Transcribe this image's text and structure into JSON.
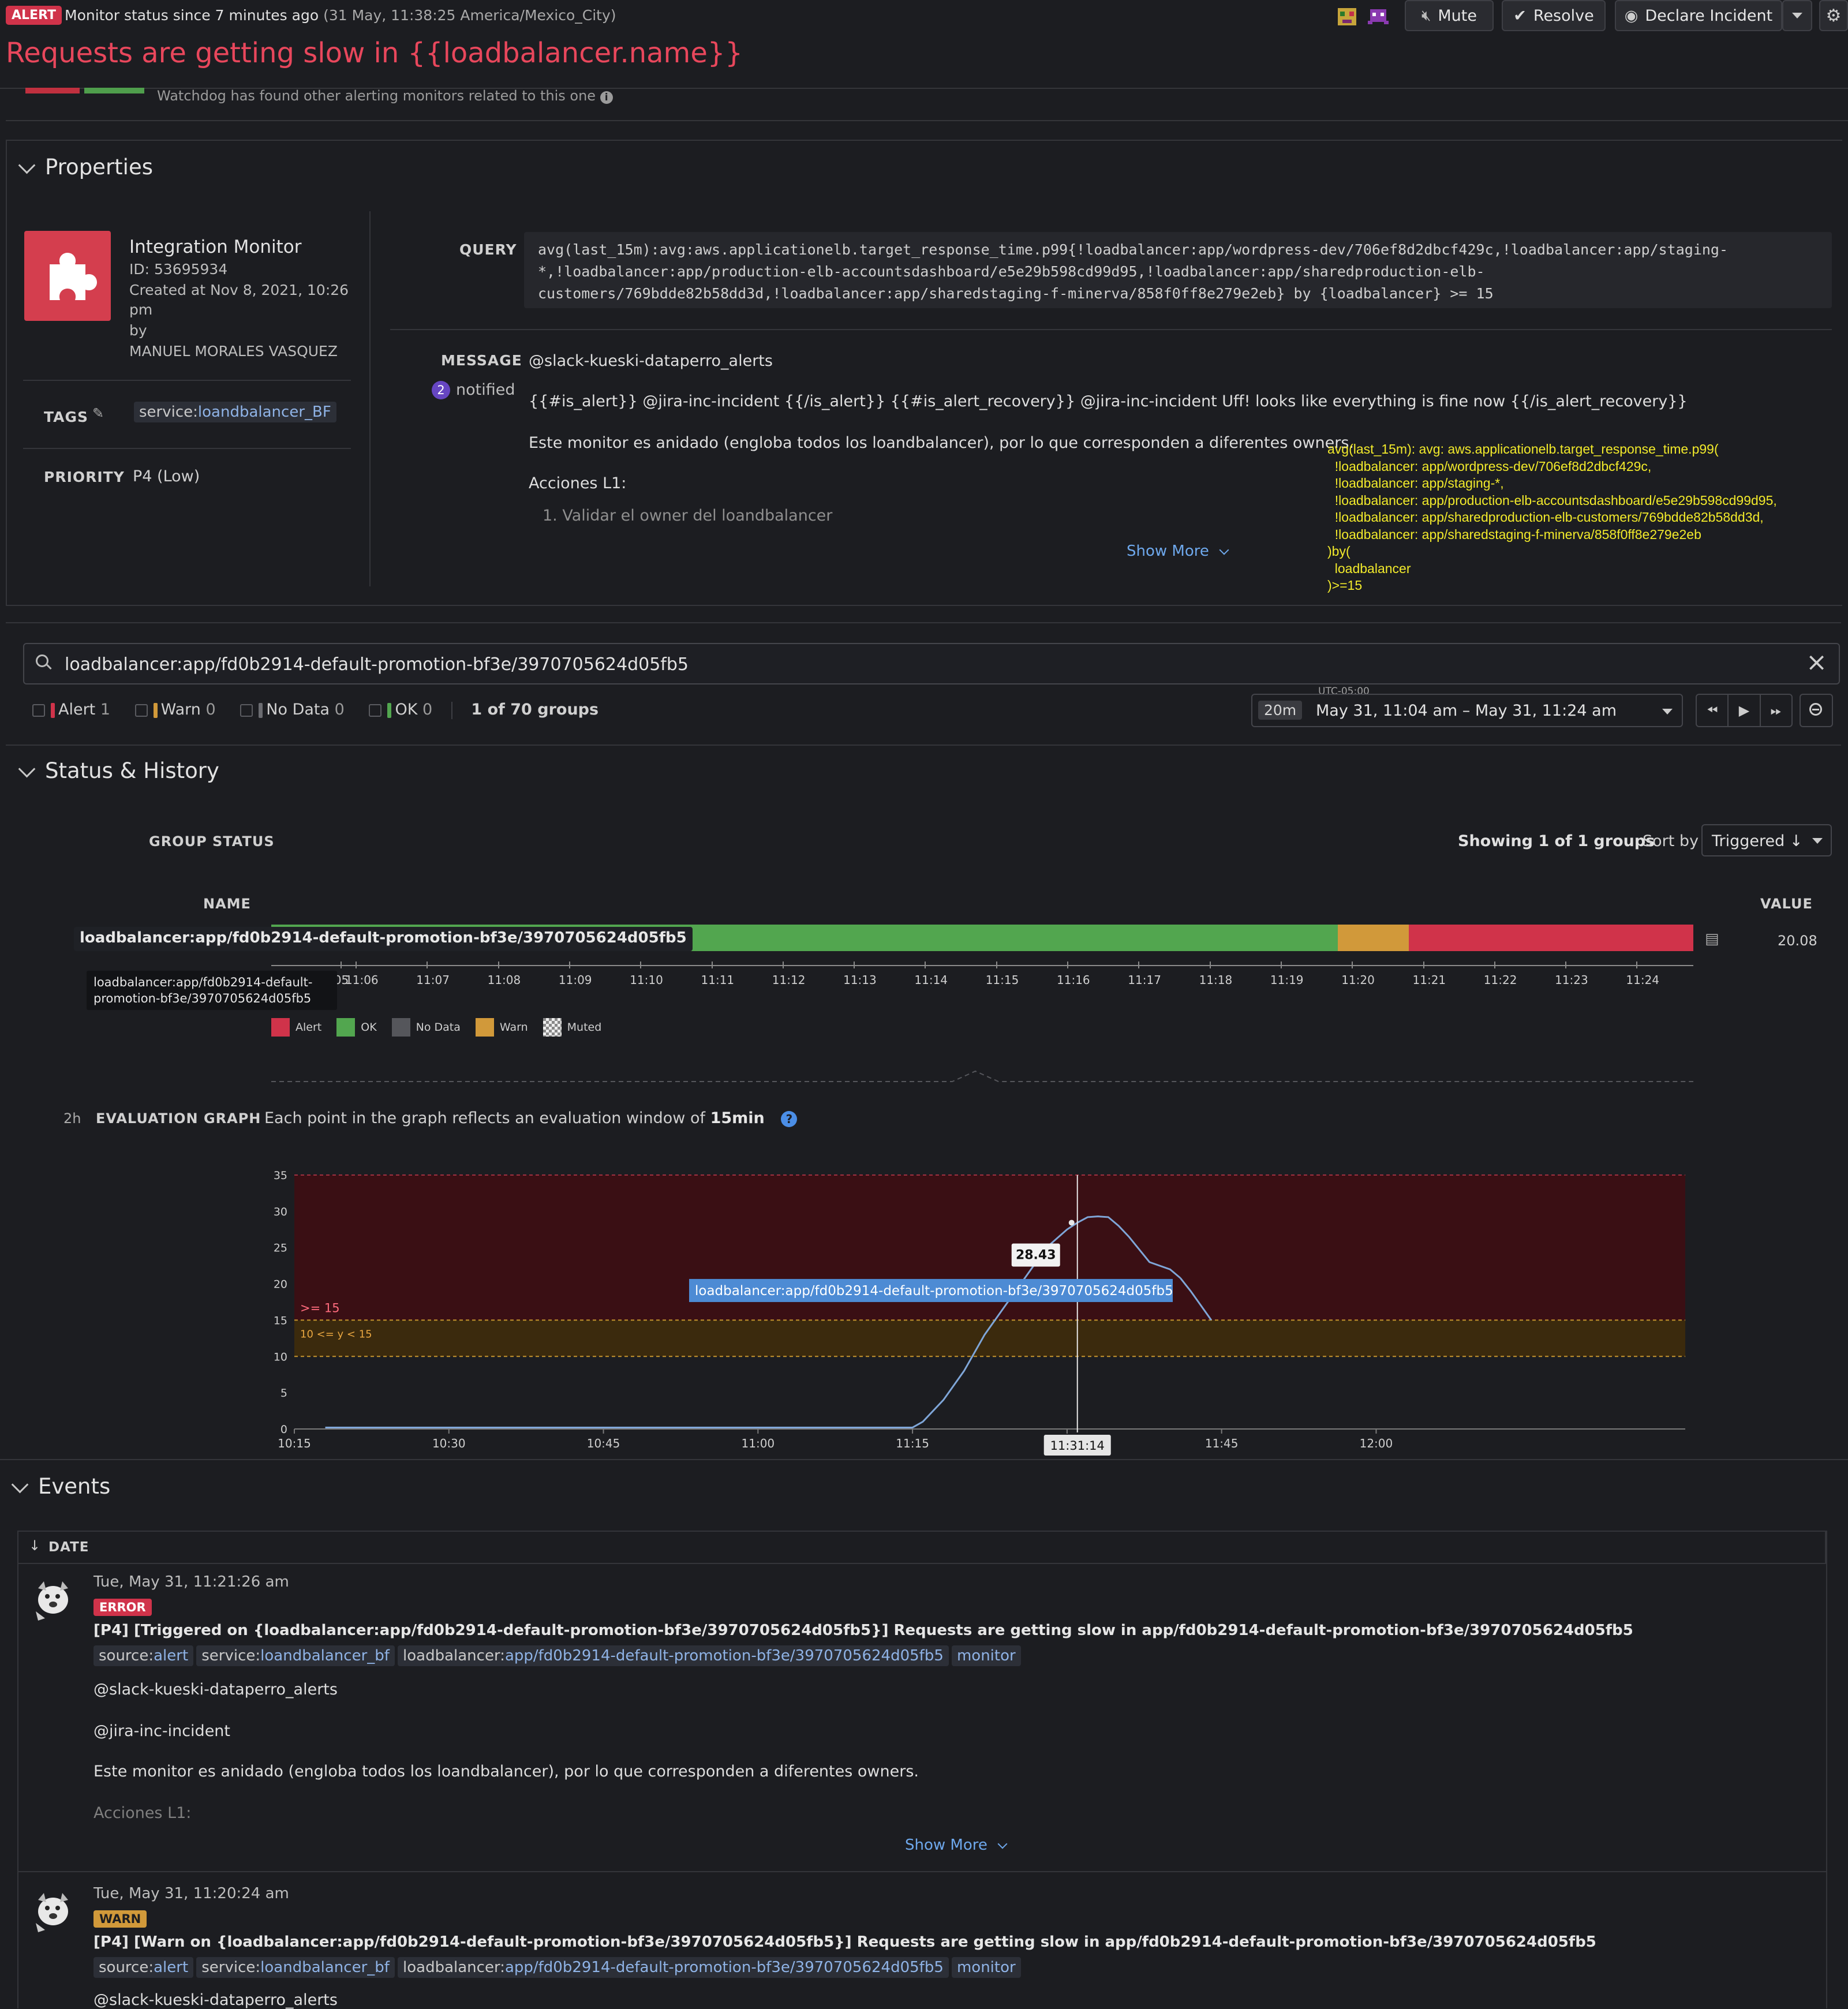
{
  "header": {
    "alert_badge": "ALERT",
    "status_text": "Monitor status since 7 minutes ago",
    "status_time": "(31 May, 11:38:25 America/Mexico_City)",
    "title": "Requests are getting slow in {{loadbalancer.name}}",
    "mute_label": "Mute",
    "resolve_label": "Resolve",
    "declare_label": "Declare Incident",
    "watchdog_text": "Watchdog has found other alerting monitors related to this one"
  },
  "properties": {
    "title": "Properties",
    "monitor_type": "Integration Monitor",
    "monitor_id": "ID: 53695934",
    "created_line1": "Created at Nov 8, 2021, 10:26",
    "created_line2": "pm",
    "created_line3": "by",
    "created_by": "MANUEL MORALES VASQUEZ",
    "tags_label": "TAGS",
    "tag_key": "service:",
    "tag_value": "loandbalancer_BF",
    "priority_label": "PRIORITY",
    "priority_value": "P4 (Low)",
    "query_label": "QUERY",
    "query_line1": "avg(last_15m):avg:aws.applicationelb.target_response_time.p99{!loadbalancer:app/wordpress-dev/706ef8d2dbcf429c,!loadbalancer:app/staging-",
    "query_line2": "*,!loadbalancer:app/production-elb-accountsdashboard/e5e29b598cd99d95,!loadbalancer:app/sharedproduction-elb-",
    "query_line3": "customers/769bdde82b58dd3d,!loadbalancer:app/sharedstaging-f-minerva/858f0ff8e279e2eb} by {loadbalancer} >= 15",
    "message_label": "MESSAGE",
    "notified_count": "2",
    "notified_label": "notified",
    "msg_line1": "@slack-kueski-dataperro_alerts",
    "msg_line2": "{{#is_alert}} @jira-inc-incident {{/is_alert}} {{#is_alert_recovery}} @jira-inc-incident Uff! looks like everything is fine now {{/is_alert_recovery}}",
    "msg_line3": "Este monitor es anidado (engloba todos los loandbalancer), por lo que corresponden a diferentes owners.",
    "msg_line4": "Acciones L1:",
    "msg_line5": "1. Validar el owner del loandbalancer",
    "show_more": "Show More",
    "overlay_lines": [
      "avg(last_15m): avg: aws.applicationelb.target_response_time.p99(",
      "  !loadbalancer: app/wordpress-dev/706ef8d2dbcf429c,",
      "  !loadbalancer: app/staging-*,",
      "  !loadbalancer: app/production-elb-accountsdashboard/e5e29b598cd99d95,",
      "  !loadbalancer: app/sharedproduction-elb-customers/769bdde82b58dd3d,",
      "  !loadbalancer: app/sharedstaging-f-minerva/858f0ff8e279e2eb",
      ")by(",
      "  loadbalancer",
      ")>=15"
    ]
  },
  "filter": {
    "search_value": "loadbalancer:app/fd0b2914-default-promotion-bf3e/3970705624d05fb5",
    "alert_label": "Alert",
    "alert_count": "1",
    "warn_label": "Warn",
    "warn_count": "0",
    "nodata_label": "No Data",
    "nodata_count": "0",
    "ok_label": "OK",
    "ok_count": "0",
    "groups_text": "1 of 70 groups",
    "tz": "UTC-05:00",
    "range_badge": "20m",
    "range_text": "May 31, 11:04 am – May 31, 11:24 am"
  },
  "status": {
    "title": "Status & History",
    "group_status_label": "GROUP STATUS",
    "showing_text": "Showing 1 of 1 groups",
    "sort_label": "Sort by",
    "sort_value": "Triggered ↓",
    "name_col": "NAME",
    "value_col": "VALUE",
    "group_name": "loadbalancer:app/fd0b2914-default-promotion-bf3e/3970705624d05fb5",
    "group_value": "20.08",
    "tooltip_line1": "loadbalancer:app/fd0b2914-default-",
    "tooltip_line2": "promotion-bf3e/3970705624d05fb5",
    "timeline_ticks": [
      ":05",
      "11:06",
      "11:07",
      "11:08",
      "11:09",
      "11:10",
      "11:11",
      "11:12",
      "11:13",
      "11:14",
      "11:15",
      "11:16",
      "11:17",
      "11:18",
      "11:19",
      "11:20",
      "11:21",
      "11:22",
      "11:23",
      "11:24"
    ],
    "timeline_segments": [
      {
        "state": "OK",
        "from": 0,
        "to": 0.75
      },
      {
        "state": "Warn",
        "from": 0.75,
        "to": 0.8
      },
      {
        "state": "Alert",
        "from": 0.8,
        "to": 1.0
      }
    ],
    "legend": [
      "Alert",
      "OK",
      "No Data",
      "Warn",
      "Muted"
    ],
    "colors": {
      "alert": "#d0334a",
      "ok": "#52a64f",
      "nodata": "#55565b",
      "warn": "#d1993a"
    }
  },
  "evaluation": {
    "range_label": "2h",
    "title": "EVALUATION GRAPH",
    "desc_prefix": "Each point in the graph reflects an evaluation window of",
    "desc_window": "15min",
    "alert_threshold_label": ">= 15",
    "warn_threshold_label": "10 <= y < 15",
    "hover_value": "28.43",
    "hover_series": "loadbalancer:app/fd0b2914-default-promotion-bf3e/3970705624d05fb5",
    "hover_time": "11:31:14"
  },
  "chart_data": {
    "type": "line",
    "title": "",
    "xlabel": "",
    "ylabel": "",
    "ylim": [
      0,
      35
    ],
    "y_ticks": [
      "0",
      "5",
      "10",
      "15",
      "20",
      "25",
      "30",
      "35"
    ],
    "x_ticks": [
      "10:15",
      "10:30",
      "10:45",
      "11:00",
      "11:15",
      "11:30",
      "11:45",
      "12:00"
    ],
    "thresholds": {
      "alert": 15,
      "warn": [
        10,
        15
      ]
    },
    "series": [
      {
        "x": [
          "10:18",
          "10:30",
          "10:45",
          "11:00",
          "11:15",
          "11:16",
          "11:18",
          "11:20",
          "11:22",
          "11:24",
          "11:26",
          "11:28",
          "11:30",
          "11:31",
          "11:32",
          "11:33",
          "11:34",
          "11:35",
          "11:36",
          "11:38",
          "11:40",
          "11:41"
        ],
        "values": [
          0.2,
          0.2,
          0.2,
          0.2,
          0.2,
          1,
          4,
          8,
          13,
          17,
          21,
          25,
          27.5,
          28.43,
          29.2,
          29.3,
          29.2,
          28,
          26.5,
          23,
          22,
          20.8
        ]
      },
      {
        "x": [
          "11:41",
          "11:42",
          "11:43",
          "11:44"
        ],
        "values": [
          20.8,
          19,
          17,
          15
        ]
      }
    ]
  },
  "events": {
    "title": "Events",
    "date_col": "DATE",
    "items": [
      {
        "date": "Tue, May 31, 11:21:26 am",
        "badge": "ERROR",
        "title": "[P4] [Triggered on {loadbalancer:app/fd0b2914-default-promotion-bf3e/3970705624d05fb5}] Requests are getting slow in app/fd0b2914-default-promotion-bf3e/3970705624d05fb5",
        "tag1_key": "source:",
        "tag1_val": "alert",
        "tag2_key": "service:",
        "tag2_val": "loandbalancer_bf",
        "tag3_key": "loadbalancer:",
        "tag3_val": "app/fd0b2914-default-promotion-bf3e/3970705624d05fb5",
        "tag4": "monitor",
        "body1": "@slack-kueski-dataperro_alerts",
        "body2": "@jira-inc-incident",
        "body3": "Este monitor es anidado (engloba todos los loandbalancer), por lo que corresponden a diferentes owners.",
        "body4": "Acciones L1:",
        "show_more": "Show More"
      },
      {
        "date": "Tue, May 31, 11:20:24 am",
        "badge": "WARN",
        "title": "[P4] [Warn on {loadbalancer:app/fd0b2914-default-promotion-bf3e/3970705624d05fb5}] Requests are getting slow in app/fd0b2914-default-promotion-bf3e/3970705624d05fb5",
        "tag1_key": "source:",
        "tag1_val": "alert",
        "tag2_key": "service:",
        "tag2_val": "loandbalancer_bf",
        "tag3_key": "loadbalancer:",
        "tag3_val": "app/fd0b2914-default-promotion-bf3e/3970705624d05fb5",
        "tag4": "monitor",
        "body1": "@slack-kueski-dataperro_alerts"
      }
    ]
  }
}
